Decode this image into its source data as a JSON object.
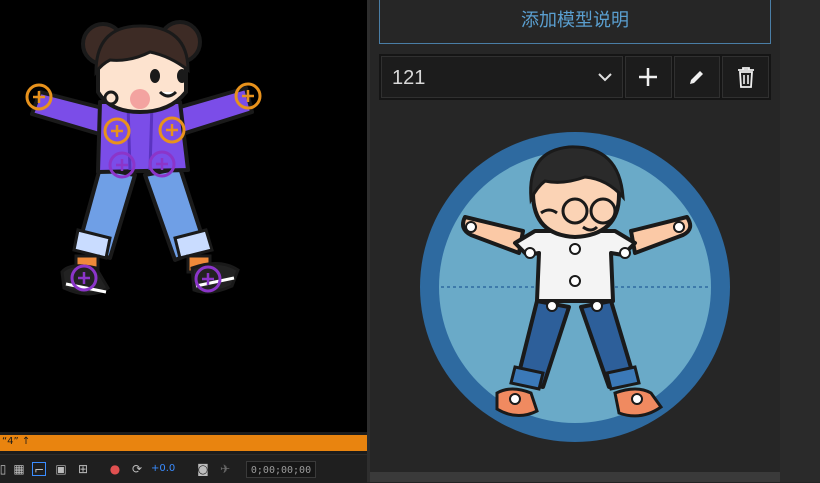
{
  "viewer": {
    "comp_label": "“4” ↑",
    "exposure_value": "+0.0",
    "timecode": "0;00;00;00"
  },
  "panel": {
    "add_description_label": "添加模型说明",
    "model_select_value": "121",
    "actions": {
      "add": "add-icon",
      "edit": "pencil-icon",
      "delete": "trash-icon"
    }
  },
  "colors": {
    "accent_blue": "#5a9fd0",
    "button_border": "#4a7ea6",
    "timeline_orange": "#e9840f",
    "handle_orange": "#e8921c",
    "handle_purple": "#8b35c9",
    "preview_ring": "#2e6aa0",
    "preview_fill": "#6aaac8"
  }
}
